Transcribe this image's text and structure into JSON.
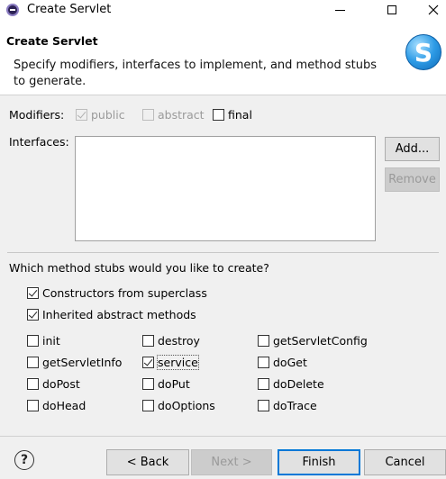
{
  "window": {
    "title": "Create Servlet"
  },
  "banner": {
    "title": "Create Servlet",
    "description": "Specify modifiers, interfaces to implement, and method stubs to generate.",
    "logo_letter": "S"
  },
  "modifiers": {
    "label": "Modifiers:",
    "public": {
      "label": "public",
      "checked": true,
      "enabled": false
    },
    "abstract": {
      "label": "abstract",
      "checked": false,
      "enabled": false
    },
    "final": {
      "label": "final",
      "checked": false,
      "enabled": true
    }
  },
  "interfaces": {
    "label": "Interfaces:",
    "items": [],
    "add_label": "Add...",
    "remove_label": "Remove"
  },
  "stubs": {
    "question": "Which method stubs would you like to create?",
    "constructors": {
      "label": "Constructors from superclass",
      "checked": true
    },
    "inherited": {
      "label": "Inherited abstract methods",
      "checked": true
    },
    "methods": [
      {
        "label": "init",
        "checked": false
      },
      {
        "label": "destroy",
        "checked": false
      },
      {
        "label": "getServletConfig",
        "checked": false
      },
      {
        "label": "getServletInfo",
        "checked": false
      },
      {
        "label": "service",
        "checked": true
      },
      {
        "label": "doGet",
        "checked": false
      },
      {
        "label": "doPost",
        "checked": false
      },
      {
        "label": "doPut",
        "checked": false
      },
      {
        "label": "doDelete",
        "checked": false
      },
      {
        "label": "doHead",
        "checked": false
      },
      {
        "label": "doOptions",
        "checked": false
      },
      {
        "label": "doTrace",
        "checked": false
      }
    ]
  },
  "footer": {
    "help_glyph": "?",
    "back_label": "< Back",
    "next_label": "Next >",
    "finish_label": "Finish",
    "cancel_label": "Cancel"
  }
}
